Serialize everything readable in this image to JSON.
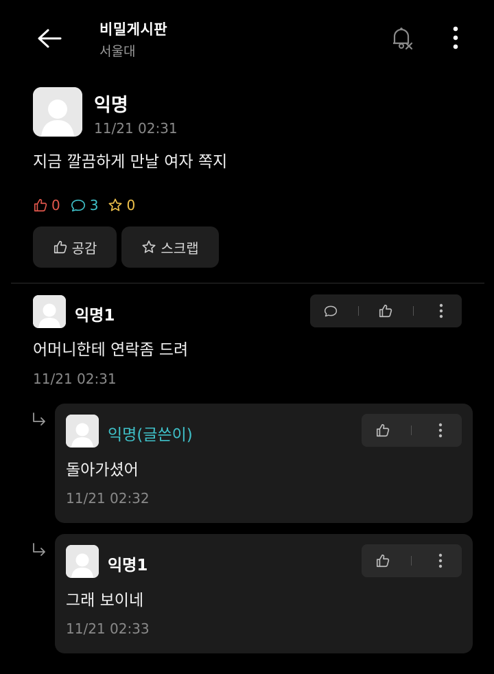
{
  "header": {
    "title": "비밀게시판",
    "subtitle": "서울대"
  },
  "post": {
    "author": "익명",
    "time": "11/21 02:31",
    "body": "지금 깔끔하게 만날 여자 쪽지",
    "likes": "0",
    "comments": "3",
    "scraps": "0",
    "like_button": "공감",
    "scrap_button": "스크랩"
  },
  "comments": [
    {
      "author": "익명1",
      "body": "어머니한테 연락좀 드려",
      "time": "11/21 02:31"
    }
  ],
  "replies": [
    {
      "author": "익명(글쓴이)",
      "body": "돌아가셨어",
      "time": "11/21 02:32"
    },
    {
      "author": "익명1",
      "body": "그래 보이네",
      "time": "11/21 02:33"
    }
  ],
  "colors": {
    "background": "#000000",
    "like": "#e2574c",
    "comment": "#3fc1c9",
    "scrap": "#f0c24b",
    "op_author": "#3fc1c9"
  }
}
